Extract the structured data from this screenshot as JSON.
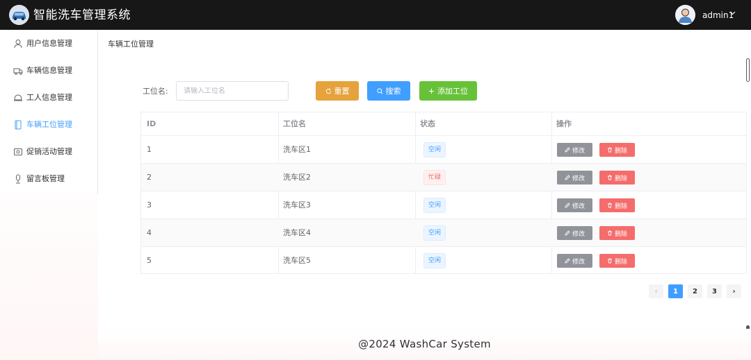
{
  "header": {
    "app_title": "智能洗车管理系统",
    "user_name": "admin1",
    "logo_icon": "car-icon",
    "avatar_icon": "user-avatar-icon"
  },
  "sidebar": {
    "items": [
      {
        "label": "用户信息管理",
        "icon": "user-icon",
        "active": false
      },
      {
        "label": "车辆信息管理",
        "icon": "truck-icon",
        "active": false
      },
      {
        "label": "工人信息管理",
        "icon": "bell-icon",
        "active": false
      },
      {
        "label": "车辆工位管理",
        "icon": "document-icon",
        "active": true
      },
      {
        "label": "促销活动管理",
        "icon": "discount-icon",
        "active": false
      },
      {
        "label": "留言板管理",
        "icon": "microphone-icon",
        "active": false
      }
    ]
  },
  "breadcrumb": "车辆工位管理",
  "search": {
    "label": "工位名:",
    "placeholder": "请输入工位名",
    "value": "",
    "reset_label": "重置",
    "search_label": "搜索",
    "add_label": "添加工位"
  },
  "table": {
    "headers": [
      "ID",
      "工位名",
      "状态",
      "操作"
    ],
    "edit_label": "修改",
    "delete_label": "删除",
    "rows": [
      {
        "id": "1",
        "name": "洗车区1",
        "status": "空闲",
        "status_type": "idle"
      },
      {
        "id": "2",
        "name": "洗车区2",
        "status": "忙碌",
        "status_type": "busy"
      },
      {
        "id": "3",
        "name": "洗车区3",
        "status": "空闲",
        "status_type": "idle"
      },
      {
        "id": "4",
        "name": "洗车区4",
        "status": "空闲",
        "status_type": "idle"
      },
      {
        "id": "5",
        "name": "洗车区5",
        "status": "空闲",
        "status_type": "idle"
      }
    ]
  },
  "pagination": {
    "pages": [
      "1",
      "2",
      "3"
    ],
    "current": "1",
    "prev": "‹",
    "next": "›"
  },
  "footer": "@2024 WashCar System",
  "colors": {
    "header_bg": "#171717",
    "primary": "#409eff",
    "warning": "#e6a23c",
    "success": "#67c23a",
    "danger": "#f56c6c",
    "info": "#909399"
  }
}
